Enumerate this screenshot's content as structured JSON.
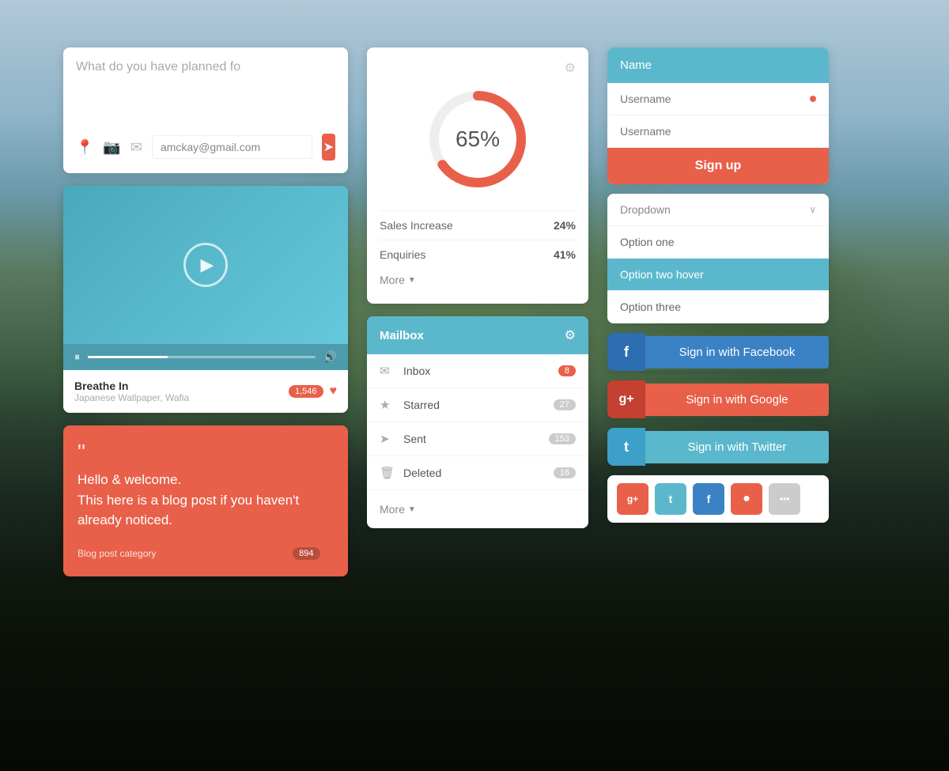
{
  "background": {
    "color_top": "#b0c8d8",
    "color_bottom": "#050a04"
  },
  "col1": {
    "post_box": {
      "placeholder": "What do you have planned fo",
      "email_value": "amckay@gmail.com",
      "email_placeholder": "amckay@gmail.com"
    },
    "video_player": {
      "song_title": "Breathe In",
      "song_artist": "Japanese Wallpaper, Wafia",
      "like_count": "1,546"
    },
    "blog_post": {
      "quote": "““",
      "text": "Hello & welcome.\nThis here is a blog post if you haven't already noticed.",
      "category": "Blog post category",
      "like_count": "894"
    }
  },
  "col2": {
    "chart": {
      "percentage": "65%",
      "progress": 65,
      "stats": [
        {
          "label": "Sales Increase",
          "value": "24%"
        },
        {
          "label": "Enquiries",
          "value": "41%"
        }
      ],
      "more_label": "More"
    },
    "mailbox": {
      "title": "Mailbox",
      "items": [
        {
          "icon": "✉",
          "label": "Inbox",
          "count": "8",
          "badge_type": "red"
        },
        {
          "icon": "★",
          "label": "Starred",
          "count": "27",
          "badge_type": "gray"
        },
        {
          "icon": "➤",
          "label": "Sent",
          "count": "153",
          "badge_type": "gray"
        },
        {
          "icon": "🗑",
          "label": "Deleted",
          "count": "16",
          "badge_type": "gray"
        }
      ],
      "more_label": "More"
    }
  },
  "col3": {
    "form": {
      "name_label": "Name",
      "username_placeholder1": "Username",
      "username_placeholder2": "Username",
      "signup_label": "Sign up"
    },
    "dropdown": {
      "label": "Dropdown",
      "options": [
        {
          "label": "Option one",
          "hover": false
        },
        {
          "label": "Option two hover",
          "hover": true
        },
        {
          "label": "Option three",
          "hover": false
        }
      ]
    },
    "social_buttons": [
      {
        "platform": "facebook",
        "icon": "f",
        "label": "Sign in with Facebook"
      },
      {
        "platform": "google",
        "icon": "g+",
        "label": "Sign in with Google"
      },
      {
        "platform": "twitter",
        "icon": "t",
        "label": "Sign in with Twitter"
      }
    ],
    "small_socials": [
      {
        "platform": "google",
        "icon": "g+",
        "class": "ss-google"
      },
      {
        "platform": "twitter",
        "icon": "t",
        "class": "ss-twitter"
      },
      {
        "platform": "facebook",
        "icon": "f",
        "class": "ss-facebook"
      },
      {
        "platform": "dribbble",
        "icon": "●",
        "class": "ss-dribbble"
      },
      {
        "platform": "more",
        "icon": "•••",
        "class": "ss-more"
      }
    ]
  }
}
